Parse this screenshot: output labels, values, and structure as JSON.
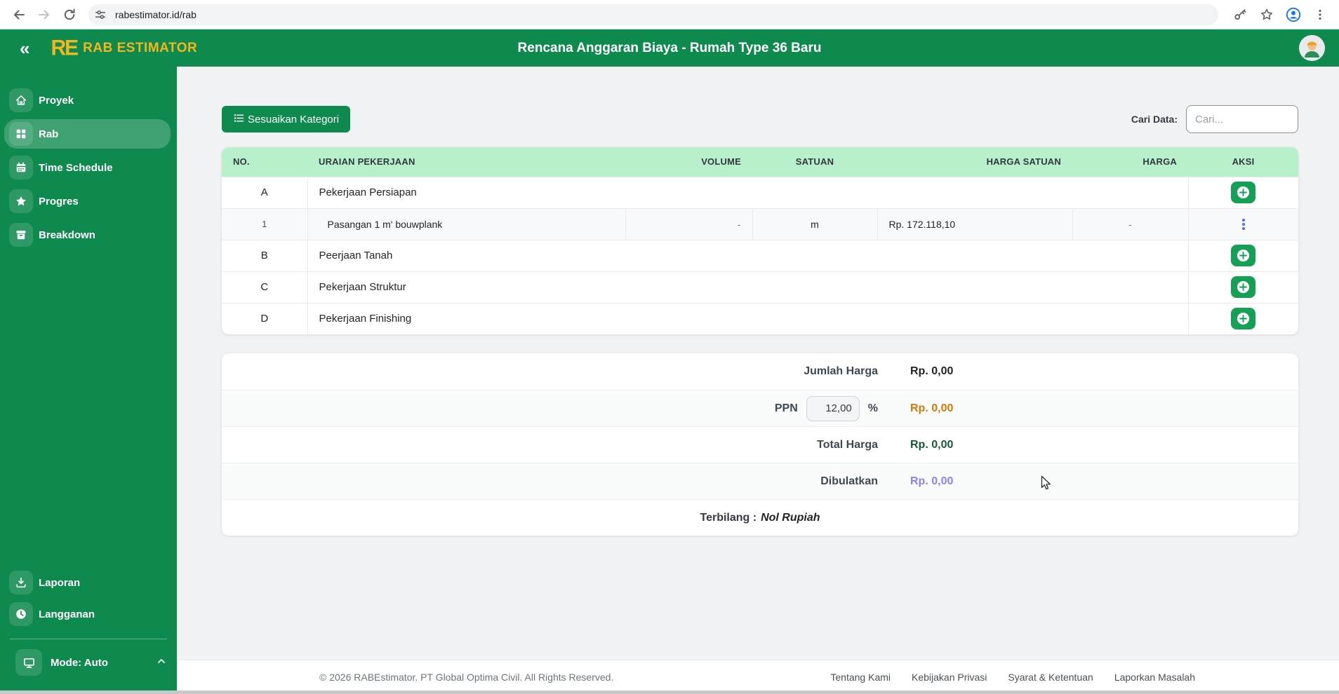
{
  "browser": {
    "url": "rabestimator.id/rab",
    "icons": [
      "back-icon",
      "forward-icon",
      "reload-icon",
      "site-settings-icon",
      "key-icon",
      "bookmark-star-icon",
      "profile-icon",
      "menu-kebab-icon"
    ]
  },
  "header": {
    "logo_mark": "RE",
    "brand": "RAB ESTIMATOR",
    "title": "Rencana Anggaran Biaya - Rumah Type 36 Baru",
    "collapse_glyph": "«"
  },
  "sidebar": {
    "items": [
      {
        "label": "Proyek",
        "icon": "home-icon",
        "active": false
      },
      {
        "label": "Rab",
        "icon": "grid-icon",
        "active": true
      },
      {
        "label": "Time Schedule",
        "icon": "calendar-icon",
        "active": false
      },
      {
        "label": "Progres",
        "icon": "star-icon",
        "active": false
      },
      {
        "label": "Breakdown",
        "icon": "archive-icon",
        "active": false
      }
    ],
    "bottom_items": [
      {
        "label": "Laporan",
        "icon": "download-icon"
      },
      {
        "label": "Langganan",
        "icon": "clock-icon"
      }
    ],
    "mode": {
      "label": "Mode: Auto",
      "icon": "monitor-icon",
      "chevron": "chevron-up-icon"
    }
  },
  "toolbar": {
    "adjust_category_label": "Sesuaikan Kategori",
    "adjust_category_icon": "list-icon",
    "search_label": "Cari Data:",
    "search_placeholder": "Cari..."
  },
  "table": {
    "columns": [
      "NO.",
      "URAIAN PEKERJAAN",
      "VOLUME",
      "SATUAN",
      "HARGA SATUAN",
      "HARGA",
      "AKSI"
    ],
    "rows": [
      {
        "type": "category",
        "no": "A",
        "uraian": "Pekerjaan Persiapan"
      },
      {
        "type": "item",
        "no": "1",
        "uraian": "Pasangan 1 m' bouwplank",
        "volume": "-",
        "satuan": "m",
        "harga_satuan": "Rp. 172.118,10",
        "harga": "-"
      },
      {
        "type": "category",
        "no": "B",
        "uraian": "Peerjaan Tanah"
      },
      {
        "type": "category",
        "no": "C",
        "uraian": "Pekerjaan Struktur"
      },
      {
        "type": "category",
        "no": "D",
        "uraian": "Pekerjaan Finishing"
      }
    ]
  },
  "summary": {
    "jumlah_harga_label": "Jumlah Harga",
    "jumlah_harga_value": "Rp. 0,00",
    "ppn_label": "PPN",
    "ppn_value": "12,00",
    "ppn_percent_sign": "%",
    "ppn_amount": "Rp. 0,00",
    "total_harga_label": "Total Harga",
    "total_harga_value": "Rp. 0,00",
    "dibulatkan_label": "Dibulatkan",
    "dibulatkan_value": "Rp. 0,00",
    "terbilang_label": "Terbilang :",
    "terbilang_value": "Nol Rupiah"
  },
  "footer": {
    "copyright": "© 2026 RABEstimator. PT Global Optima Civil. All Rights Reserved.",
    "links": [
      "Tentang Kami",
      "Kebijakan Privasi",
      "Syarat & Ketentuan",
      "Laporkan Masalah"
    ]
  },
  "colors": {
    "brand_green": "#0f8a4e",
    "brand_yellow": "#f2b61e",
    "table_header_mint": "#b9f0cc",
    "add_button_green": "#15a155",
    "kebab_blue": "#4a6cf0",
    "ppn_amount_orange": "#d97706",
    "total_green": "#185a34",
    "dibulatkan_purple": "#8c82f0"
  }
}
